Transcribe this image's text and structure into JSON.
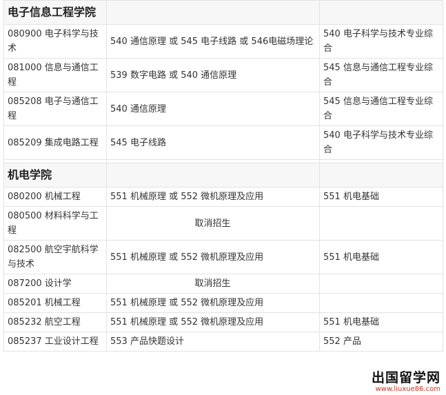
{
  "sections": [
    {
      "name": "电子信息工程学院",
      "rows": [
        {
          "major": "080900 电子科学与技术",
          "exam": "540 通信原理 或 545 电子线路 或 546电磁场理论",
          "retest": "540 电子科学与技术专业综合"
        },
        {
          "major": "081000 信息与通信工程",
          "exam": "539 数字电路 或 540 通信原理",
          "retest": "545 信息与通信工程专业综合"
        },
        {
          "major": "085208 电子与通信工程",
          "exam": "540 通信原理",
          "retest": "545 信息与通信工程专业综合"
        },
        {
          "major": "085209 集成电路工程",
          "exam": "545 电子线路",
          "retest": "540 电子科学与技术专业综合"
        }
      ]
    },
    {
      "name": "机电学院",
      "rows": [
        {
          "major": "080200 机械工程",
          "exam": "551 机械原理 或 552 微机原理及应用",
          "retest": "551 机电基础"
        },
        {
          "major": "080500 材料科学与工程",
          "exam": "取消招生",
          "retest": ""
        },
        {
          "major": "082500 航空宇航科学与技术",
          "exam": "551 机械原理 或 552 微机原理及应用",
          "retest": "551 机电基础"
        },
        {
          "major": "087200 设计学",
          "exam": "取消招生",
          "retest": ""
        },
        {
          "major": "085201 机械工程",
          "exam": "551 机械原理 或 552 微机原理及应用",
          "retest": ""
        },
        {
          "major": "085232 航空工程",
          "exam": "551 机械原理 或 552 微机原理及应用",
          "retest": "551 机电基础"
        },
        {
          "major": "085237 工业设计工程",
          "exam": "553 产品快题设计",
          "retest": "552 产品"
        }
      ]
    }
  ],
  "watermark": {
    "title": "出国留学网",
    "url": "www.liuxue86.com"
  }
}
